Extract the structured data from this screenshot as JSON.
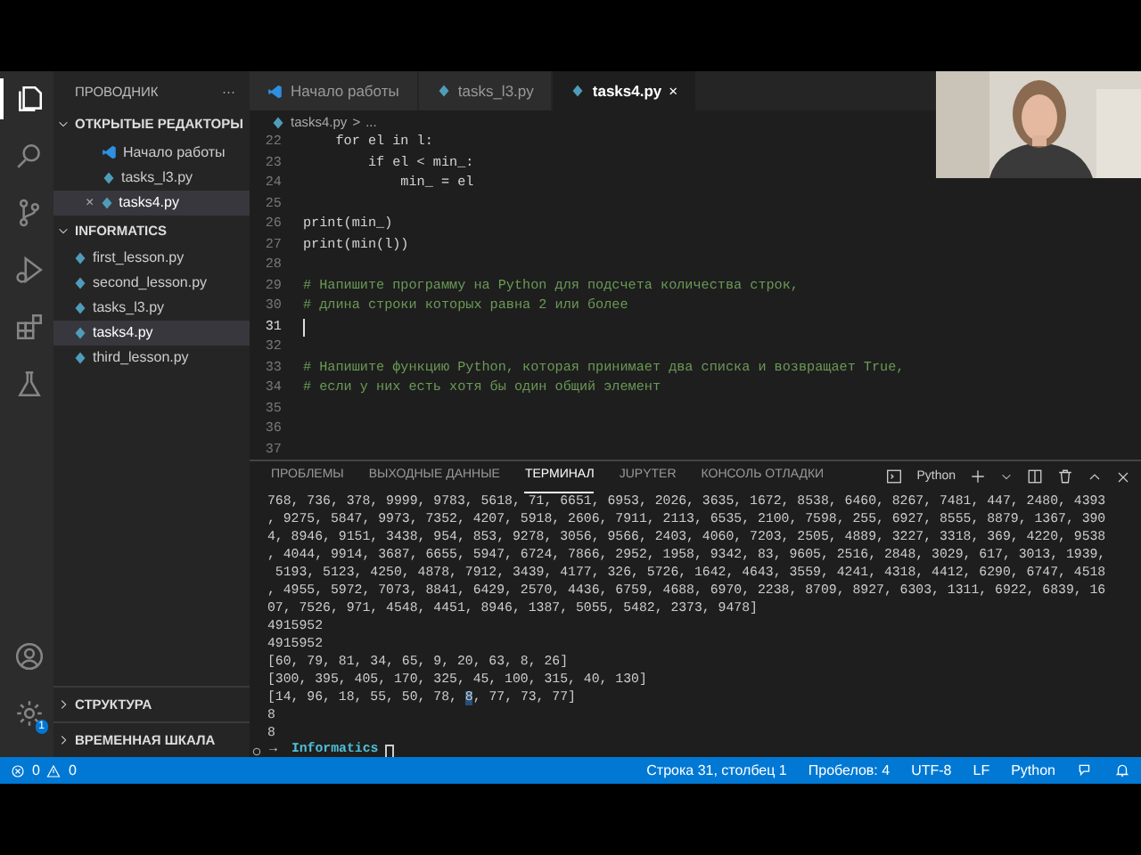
{
  "activity_bar": {
    "items": [
      {
        "kind": "files",
        "selected": true
      },
      {
        "kind": "search",
        "selected": false
      },
      {
        "kind": "branch",
        "selected": false
      },
      {
        "kind": "run",
        "selected": false
      },
      {
        "kind": "extensions",
        "selected": false
      },
      {
        "kind": "flask",
        "selected": false
      }
    ],
    "bottom": [
      {
        "kind": "account"
      },
      {
        "kind": "gear",
        "badge": "1"
      }
    ]
  },
  "sidebar": {
    "title": "ПРОВОДНИК",
    "more": "···",
    "sections": [
      {
        "label": "ОТКРЫТЫЕ РЕДАКТОРЫ",
        "expanded": true,
        "items": [
          {
            "label": "Начало работы",
            "kind": "welcome",
            "selected": false
          },
          {
            "label": "tasks_l3.py",
            "kind": "python",
            "selected": false
          },
          {
            "label": "tasks4.py",
            "kind": "python",
            "selected": true,
            "close": "×"
          }
        ]
      },
      {
        "label": "INFORMATICS",
        "expanded": true,
        "items": [
          {
            "label": "first_lesson.py",
            "kind": "python",
            "selected": false
          },
          {
            "label": "second_lesson.py",
            "kind": "python",
            "selected": false
          },
          {
            "label": "tasks_l3.py",
            "kind": "python",
            "selected": false
          },
          {
            "label": "tasks4.py",
            "kind": "python",
            "selected": true
          },
          {
            "label": "third_lesson.py",
            "kind": "python",
            "selected": false
          }
        ]
      }
    ],
    "bottom_sections": [
      {
        "label": "СТРУКТУРА",
        "expanded": false
      },
      {
        "label": "ВРЕМЕННАЯ ШКАЛА",
        "expanded": false
      }
    ]
  },
  "editor_tabs": [
    {
      "label": "Начало работы",
      "kind": "welcome",
      "selected": false
    },
    {
      "label": "tasks_l3.py",
      "kind": "python",
      "selected": false
    },
    {
      "label": "tasks4.py",
      "kind": "python",
      "selected": true,
      "close": "×"
    }
  ],
  "breadcrumb": [
    "tasks4.py",
    ">",
    "..."
  ],
  "code_lines": [
    {
      "number": "22",
      "kind": "code",
      "text": "    for el in l:"
    },
    {
      "number": "23",
      "kind": "code",
      "text": "        if el < min_:"
    },
    {
      "number": "24",
      "kind": "code",
      "text": "            min_ = el"
    },
    {
      "number": "25"
    },
    {
      "number": "26",
      "kind": "code",
      "text": "print(min_)"
    },
    {
      "number": "27",
      "kind": "code",
      "text": "print(min(l))"
    },
    {
      "number": "28"
    },
    {
      "number": "29",
      "kind": "comment",
      "text": "# Напишите программу на Python для подсчета количества строк,"
    },
    {
      "number": "30",
      "kind": "comment",
      "text": "# длина строки которых равна 2 или более"
    },
    {
      "number": "31",
      "current": true
    },
    {
      "number": "32"
    },
    {
      "number": "33",
      "kind": "comment",
      "text": "# Напишите функцию Python, которая принимает два списка и возвращает True,"
    },
    {
      "number": "34",
      "kind": "comment",
      "text": "# если у них есть хотя бы один общий элемент"
    },
    {
      "number": "35"
    },
    {
      "number": "36"
    },
    {
      "number": "37"
    }
  ],
  "panel": {
    "tabs": [
      {
        "label": "ПРОБЛЕМЫ",
        "selected": false
      },
      {
        "label": "ВЫХОДНЫЕ ДАННЫЕ",
        "selected": false
      },
      {
        "label": "ТЕРМИНАЛ",
        "selected": true
      },
      {
        "label": "JUPYTER",
        "selected": false
      },
      {
        "label": "КОНСОЛЬ ОТЛАДКИ",
        "selected": false
      }
    ],
    "terminal_name": "Python",
    "lines": [
      {
        "segments": [
          {
            "text": "768, 736, 378, 9999, 9783, 5618, 71, 6651, 6953, 2026, 3635, 1672, 8538, 6460, 8267, 7481, 447, 2480, 4393",
            "selected": false
          }
        ]
      },
      {
        "segments": [
          {
            "text": ", 9275, 5847, 9973, 7352, 4207, 5918, 2606, 7911, 2113, 6535, 2100, 7598, 255, 6927, 8555, 8879, 1367, 390",
            "selected": false
          }
        ]
      },
      {
        "segments": [
          {
            "text": "4, 8946, 9151, 3438, 954, 853, 9278, 3056, 9566, 2403, 4060, 7203, 2505, 4889, 3227, 3318, 369, 4220, 9538",
            "selected": false
          }
        ]
      },
      {
        "segments": [
          {
            "text": ", 4044, 9914, 3687, 6655, 5947, 6724, 7866, 2952, 1958, 9342, 83, 9605, 2516, 2848, 3029, 617, 3013, 1939,",
            "selected": false
          }
        ]
      },
      {
        "segments": [
          {
            "text": " 5193, 5123, 4250, 4878, 7912, 3439, 4177, 326, 5726, 1642, 4643, 3559, 4241, 4318, 4412, 6290, 6747, 4518",
            "selected": false
          }
        ]
      },
      {
        "segments": [
          {
            "text": ", 4955, 5972, 7073, 8841, 6429, 2570, 4436, 6759, 4688, 6970, 2238, 8709, 8927, 6303, 1311, 6922, 6839, 16",
            "selected": false
          }
        ]
      },
      {
        "segments": [
          {
            "text": "07, 7526, 971, 4548, 4451, 8946, 1387, 5055, 5482, 2373, 9478]",
            "selected": false
          }
        ]
      },
      {
        "segments": [
          {
            "text": "4915952",
            "selected": false
          }
        ]
      },
      {
        "segments": [
          {
            "text": "4915952",
            "selected": false
          }
        ]
      },
      {
        "segments": [
          {
            "text": "[60, 79, 81, 34, 65, 9, 20, 63, 8, 26]",
            "selected": false
          }
        ]
      },
      {
        "segments": [
          {
            "text": "[300, 395, 405, 170, 325, 45, 100, 315, 40, 130]",
            "selected": false
          }
        ]
      },
      {
        "segments": [
          {
            "text": "[14, 96, 18, 55, 50, 78, ",
            "selected": false
          },
          {
            "text": "8",
            "selected": true
          },
          {
            "text": ", 77, 73, 77]",
            "selected": false
          }
        ]
      },
      {
        "segments": [
          {
            "text": "8",
            "selected": false
          }
        ]
      },
      {
        "segments": [
          {
            "text": "8",
            "selected": false
          }
        ]
      }
    ],
    "prompt": {
      "arrow": "→",
      "directory": "Informatics"
    }
  },
  "status_bar": {
    "errors": "0",
    "warnings": "0",
    "items": [
      "Строка 31, столбец 1",
      "Пробелов: 4",
      "UTF-8",
      "LF",
      "Python"
    ]
  }
}
